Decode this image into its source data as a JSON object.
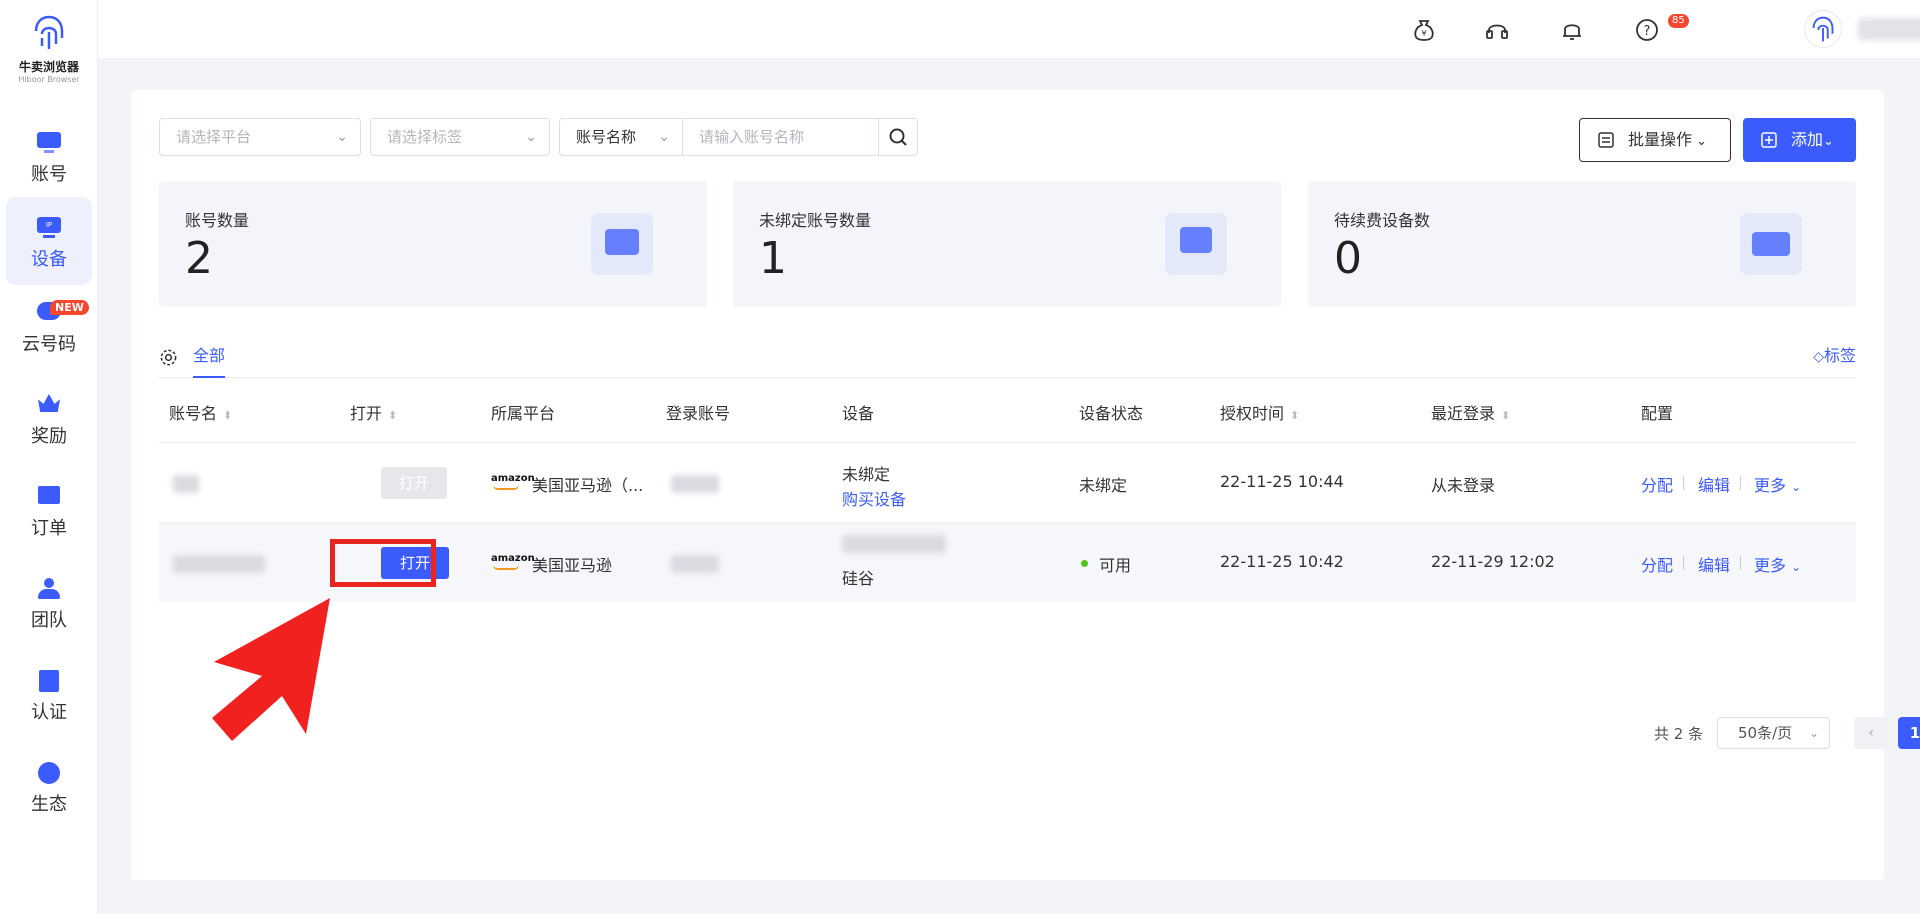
{
  "brand": {
    "name": "牛卖浏览器",
    "sub": "Hiboor Browser"
  },
  "nav": [
    {
      "label": "账号",
      "icon": "monitor-icon"
    },
    {
      "label": "设备",
      "icon": "ip-device-icon"
    },
    {
      "label": "云号码",
      "icon": "cloud-icon"
    },
    {
      "label": "奖励",
      "icon": "crown-icon"
    },
    {
      "label": "订单",
      "icon": "order-icon"
    },
    {
      "label": "团队",
      "icon": "team-icon"
    },
    {
      "label": "认证",
      "icon": "certify-icon"
    },
    {
      "label": "生态",
      "icon": "ecosystem-icon"
    }
  ],
  "nav_new_badge": "NEW",
  "topbar": {
    "notifications": "85"
  },
  "filters": {
    "platform_placeholder": "请选择平台",
    "tag_placeholder": "请选择标签",
    "search_field": "账号名称",
    "search_placeholder": "请输入账号名称"
  },
  "actions": {
    "batch": "批量操作",
    "add": "添加"
  },
  "stats": [
    {
      "title": "账号数量",
      "value": "2"
    },
    {
      "title": "未绑定账号数量",
      "value": "1"
    },
    {
      "title": "待续费设备数",
      "value": "0"
    }
  ],
  "tabs": {
    "all": "全部",
    "tag": "标签"
  },
  "columns": [
    "账号名",
    "打开",
    "所属平台",
    "登录账号",
    "设备",
    "设备状态",
    "授权时间",
    "最近登录",
    "配置"
  ],
  "rows": [
    {
      "open": "打开",
      "platform": "美国亚马逊（...",
      "device": "未绑定",
      "device_link": "购买设备",
      "status": "未绑定",
      "auth_time": "22-11-25 10:44",
      "last_login": "从未登录",
      "ops": [
        "分配",
        "编辑",
        "更多"
      ]
    },
    {
      "open": "打开",
      "platform": "美国亚马逊",
      "device": "硅谷",
      "status": "可用",
      "auth_time": "22-11-25 10:42",
      "last_login": "22-11-29 12:02",
      "ops": [
        "分配",
        "编辑",
        "更多"
      ]
    }
  ],
  "amazon_logo": "amazon",
  "pager": {
    "total": "共 2 条",
    "size": "50条/页",
    "current": "1"
  },
  "colors": {
    "accent": "#3b5bfd",
    "highlight": "#e8251f"
  }
}
